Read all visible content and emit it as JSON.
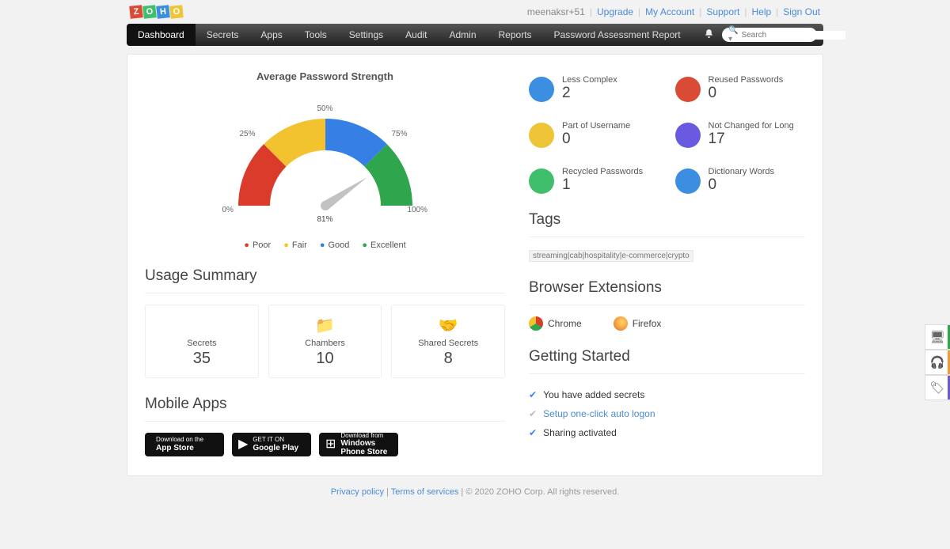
{
  "topbar": {
    "username": "meenaksr+51",
    "links": [
      "Upgrade",
      "My Account",
      "Support",
      "Help",
      "Sign Out"
    ]
  },
  "nav": {
    "tabs": [
      "Dashboard",
      "Secrets",
      "Apps",
      "Tools",
      "Settings",
      "Audit",
      "Admin",
      "Reports",
      "Password Assessment Report"
    ],
    "active": 0,
    "search_placeholder": "Search"
  },
  "gauge": {
    "title": "Average Password Strength",
    "value_label": "81%",
    "value_pct": 81,
    "ticks": [
      "0%",
      "25%",
      "50%",
      "75%",
      "100%"
    ],
    "legend": [
      "Poor",
      "Fair",
      "Good",
      "Excellent"
    ]
  },
  "stats": [
    {
      "label": "Less Complex",
      "value": "2",
      "color": "#3b8ee0"
    },
    {
      "label": "Reused Passwords",
      "value": "0",
      "color": "#d94b35"
    },
    {
      "label": "Part of Username",
      "value": "0",
      "color": "#eec537"
    },
    {
      "label": "Not Changed for Long",
      "value": "17",
      "color": "#6a5ae0"
    },
    {
      "label": "Recycled Passwords",
      "value": "1",
      "color": "#3fbf6b"
    },
    {
      "label": "Dictionary Words",
      "value": "0",
      "color": "#3b8ee0"
    }
  ],
  "usage": {
    "title": "Usage Summary",
    "cards": [
      {
        "label": "Secrets",
        "value": "35"
      },
      {
        "label": "Chambers",
        "value": "10"
      },
      {
        "label": "Shared Secrets",
        "value": "8"
      }
    ]
  },
  "mobile": {
    "title": "Mobile Apps",
    "buttons": [
      {
        "top": "Download on the",
        "bottom": "App Store"
      },
      {
        "top": "GET IT ON",
        "bottom": "Google Play"
      },
      {
        "top": "Download from",
        "bottom": "Windows Phone Store"
      }
    ]
  },
  "tags": {
    "title": "Tags",
    "items": [
      "streaming",
      "cab",
      "hospitality",
      "e-commerce",
      "crypto"
    ]
  },
  "ext": {
    "title": "Browser Extensions",
    "items": [
      "Chrome",
      "Firefox"
    ]
  },
  "gs": {
    "title": "Getting Started",
    "items": [
      {
        "done": true,
        "text": "You have added secrets",
        "link": false
      },
      {
        "done": false,
        "text": "Setup one-click auto logon",
        "link": true
      },
      {
        "done": true,
        "text": "Sharing activated",
        "link": false
      }
    ]
  },
  "footer": {
    "privacy": "Privacy policy",
    "terms": "Terms of services",
    "copyright": "© 2020  ZOHO Corp. All rights reserved."
  },
  "chart_data": {
    "type": "gauge",
    "title": "Average Password Strength",
    "value": 81,
    "min": 0,
    "max": 100,
    "ticks": [
      0,
      25,
      50,
      75,
      100
    ],
    "segments": [
      {
        "name": "Poor",
        "range": [
          0,
          25
        ],
        "color": "#db3b2b"
      },
      {
        "name": "Fair",
        "range": [
          25,
          50
        ],
        "color": "#f2c32f"
      },
      {
        "name": "Good",
        "range": [
          50,
          75
        ],
        "color": "#367fe4"
      },
      {
        "name": "Excellent",
        "range": [
          75,
          100
        ],
        "color": "#2fa64e"
      }
    ]
  }
}
